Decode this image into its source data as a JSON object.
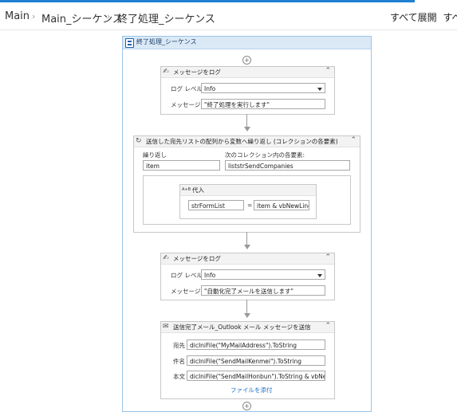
{
  "breadcrumb": {
    "items": [
      "Main",
      "Main_シーケンス",
      "終了処理_シーケンス"
    ],
    "expand_all": "すべて展開",
    "truncated": "すべ"
  },
  "sequence": {
    "title": "終了処理_シーケンス"
  },
  "log1": {
    "title": "メッセージをログ",
    "level_label": "ログ レベル",
    "level_value": "Info",
    "message_label": "メッセージ",
    "message_value": "\"終了処理を実行します\""
  },
  "foreach": {
    "title": "送信した宛先リストの配列から変数へ繰り返し (コレクションの各要素)",
    "repeat_label": "繰り返し",
    "repeat_value": "item",
    "collection_label": "次のコレクション内の各要素:",
    "collection_value": "liststrSendCompanies",
    "assign": {
      "title": "代入",
      "icon_text": "A+B",
      "left_value": "strFormList",
      "equals": "=",
      "right_value": "item & vbNewLine"
    }
  },
  "log2": {
    "title": "メッセージをログ",
    "level_label": "ログ レベル",
    "level_value": "Info",
    "message_label": "メッセージ",
    "message_value": "\"自動化完了メールを送信します\""
  },
  "mail": {
    "title": "送信完了メール_Outlook メール メッセージを送信",
    "to_label": "宛先",
    "to_value": "dicIniFile(\"MyMailAddress\").ToString",
    "subject_label": "件名",
    "subject_value": "dicIniFile(\"SendMailKenmei\").ToString",
    "body_label": "本文",
    "body_value": "dicIniFile(\"SendMailHonbun\").ToString & vbNew",
    "attach_link": "ファイルを添付"
  },
  "colors": {
    "accent": "#1f7fd1",
    "sequence_header": "#dbe9f7",
    "link": "#1e6fc7"
  }
}
